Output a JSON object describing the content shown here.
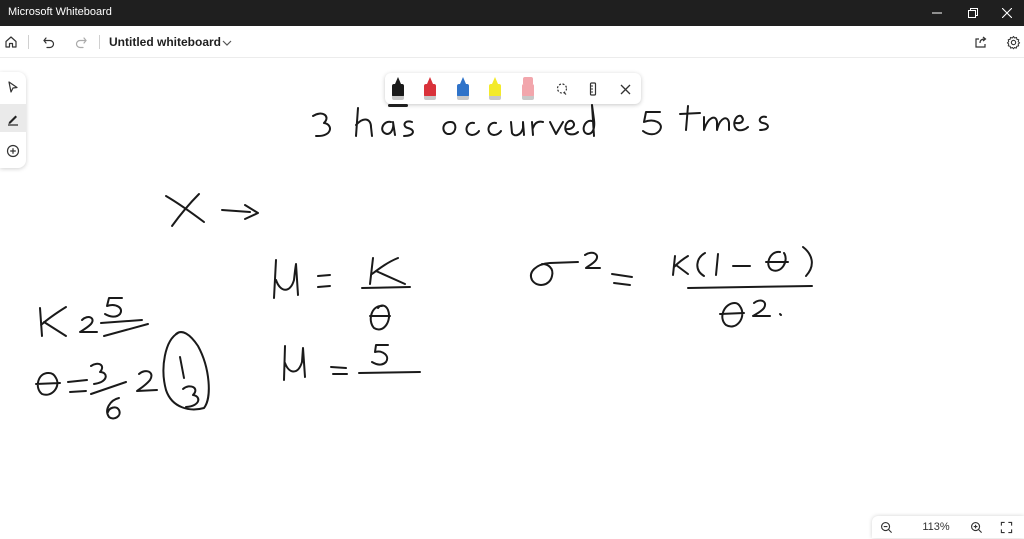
{
  "window": {
    "title": "Microsoft Whiteboard",
    "minimize_icon": "minimize-icon",
    "restore_icon": "restore-icon",
    "close_icon": "close-icon"
  },
  "appbar": {
    "home_icon": "home-icon",
    "undo_icon": "undo-icon",
    "redo_icon": "redo-icon",
    "board_title": "Untitled whiteboard",
    "share_icon": "share-icon",
    "settings_icon": "gear-icon"
  },
  "left_rail": {
    "tools": [
      "select-icon",
      "inking-icon",
      "add-icon"
    ],
    "active_tool": "inking-icon"
  },
  "ink_toolbar": {
    "pens": [
      {
        "name": "black-pen",
        "color": "#1a1a1a"
      },
      {
        "name": "red-pen",
        "color": "#d9323a"
      },
      {
        "name": "blue-pen",
        "color": "#2f73c9"
      },
      {
        "name": "yellow-highlighter",
        "color": "#f3ea2a"
      },
      {
        "name": "eraser",
        "color": "#f2a6ac"
      }
    ],
    "selected_pen": "black-pen",
    "lasso_icon": "lasso-icon",
    "ruler_icon": "ruler-icon",
    "close_icon": "close-icon"
  },
  "zoom": {
    "zoom_out_icon": "zoom-out-icon",
    "level": "113%",
    "zoom_in_icon": "zoom-in-icon",
    "fit_icon": "fit-screen-icon"
  },
  "colors": {
    "titlebar": "#1f1f1f",
    "ink": "#1a1a1a"
  }
}
